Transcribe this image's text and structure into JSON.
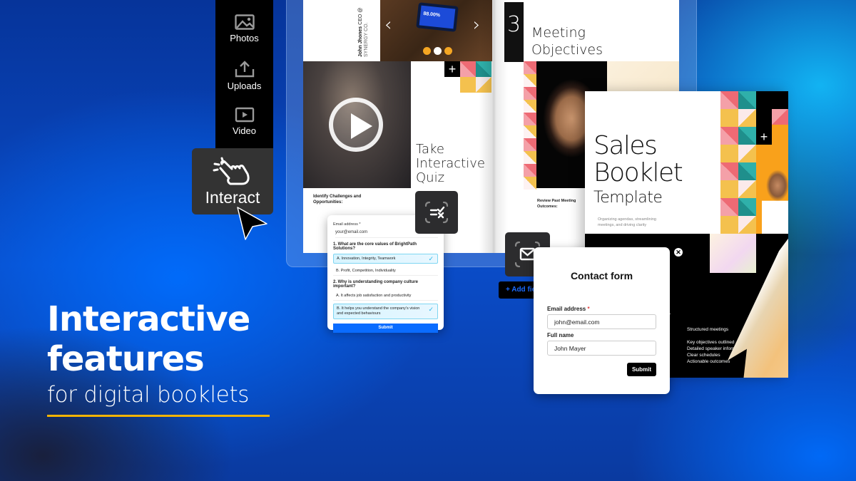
{
  "colors": {
    "accent_blue": "#0a6cff",
    "underline_yellow": "#f5b400",
    "carousel_dot": "#f5a623",
    "orange": "#f9a11b",
    "mosaic_pink": "#ee6a74",
    "mosaic_yellow": "#f4c14e",
    "mosaic_teal": "#1f8f8c"
  },
  "toolbar": {
    "items": [
      {
        "label": "Photos",
        "icon": "image-icon"
      },
      {
        "label": "Uploads",
        "icon": "upload-icon"
      },
      {
        "label": "Video",
        "icon": "video-icon"
      }
    ],
    "interact": {
      "label": "Interact",
      "icon": "tap-hand-icon"
    }
  },
  "headline": {
    "line1": "Interactive",
    "line2": "features",
    "subline": "for digital booklets"
  },
  "booklet_left": {
    "credit_name": "John Jhones",
    "credit_role": "CEO @",
    "credit_company": "SYNERGY CO.",
    "tablet_text": "88.00%",
    "carousel_prev": "‹",
    "carousel_next": "›",
    "carousel_active_dot": 1,
    "carousel_dot_count": 3,
    "quiz_title_1": "Take",
    "quiz_title_2": "Interactive",
    "quiz_title_3": "Quiz",
    "caption": "Identify Challenges and Opportunities:",
    "plus": "+"
  },
  "booklet_right": {
    "section_number": "3",
    "title_1": "Meeting",
    "title_2": "Objectives",
    "caption": "Review Past Meeting Outcomes:"
  },
  "quiz_form": {
    "email_label": "Email address *",
    "email_value": "your@email.com",
    "q1": "1. What are the core values of BrightPath Solutions?",
    "q1_options": [
      {
        "label": "A.        Innovation, Integrity, Teamwork",
        "selected": true
      },
      {
        "label": "B. Profit, Competition, Individuality",
        "selected": false
      }
    ],
    "q2": "2. Why is understanding company culture important?",
    "q2_options": [
      {
        "label": "A. It affects job satisfaction and productivity",
        "selected": false
      },
      {
        "label": "B. It helps you understand the company's vision and expected behaviours",
        "selected": true
      }
    ],
    "submit_label": "Submit",
    "check": "✓"
  },
  "icons": {
    "quiz_icon": "quiz-checklist-icon",
    "mail_icon": "mail-icon"
  },
  "add_field": {
    "label": "+  Add field"
  },
  "sales_booklet": {
    "title_1": "Sales",
    "title_2": "Booklet",
    "title_3": "Template",
    "subtitle": "Organizing agendas, streamlining meetings, and driving clarity",
    "plus": "+",
    "close": "✕",
    "list_heading": "Structured meetings",
    "list_items": [
      "Key objectives outlined",
      "Detailed speaker information",
      "Clear schedules",
      "Actionable outcomes"
    ]
  },
  "contact_form": {
    "title": "Contact form",
    "email_label": "Email address",
    "required_mark": "*",
    "email_value": "john@email.com",
    "name_label": "Full name",
    "name_value": "John Mayer",
    "submit_label": "Submit"
  }
}
